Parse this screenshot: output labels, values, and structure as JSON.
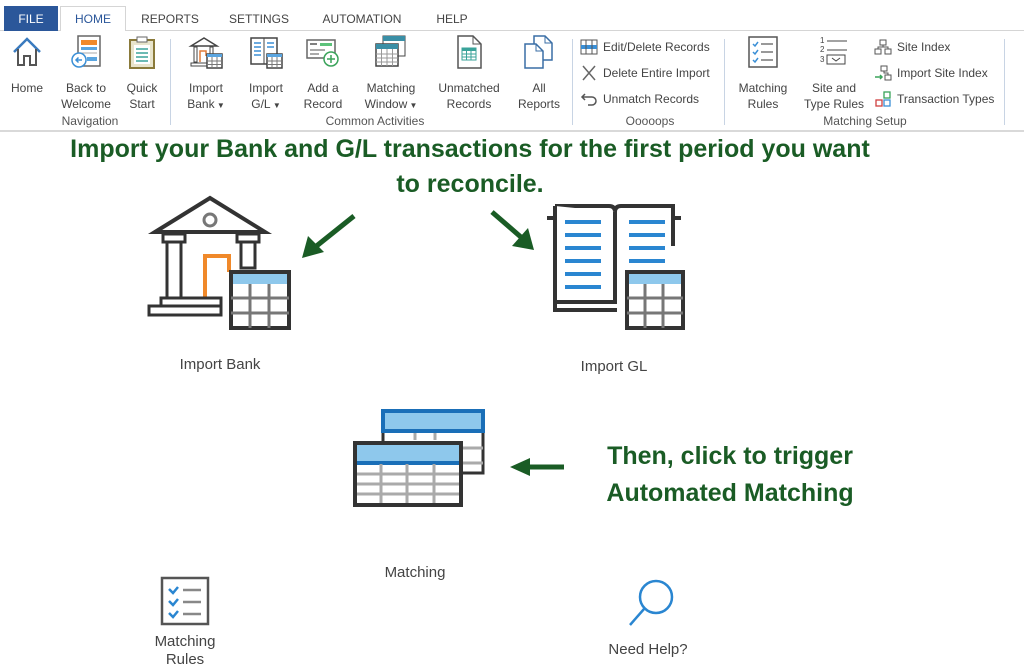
{
  "tabs": [
    "FILE",
    "HOME",
    "REPORTS",
    "SETTINGS",
    "AUTOMATION",
    "HELP"
  ],
  "active_tab": "HOME",
  "ribbon": {
    "navigation": {
      "group_label": "Navigation",
      "buttons": [
        {
          "label": "Home",
          "icon": "home-icon"
        },
        {
          "label": "Back to\nWelcome",
          "icon": "back-icon"
        },
        {
          "label": "Quick\nStart",
          "icon": "clipboard-icon"
        }
      ]
    },
    "common": {
      "group_label": "Common Activities",
      "buttons": [
        {
          "label": "Import\nBank",
          "icon": "bank-icon",
          "dropdown": true
        },
        {
          "label": "Import\nG/L",
          "icon": "ledger-icon",
          "dropdown": true
        },
        {
          "label": "Add a\nRecord",
          "icon": "add-record-icon"
        },
        {
          "label": "Matching\nWindow",
          "icon": "matching-window-icon",
          "dropdown": true
        },
        {
          "label": "Unmatched\nRecords",
          "icon": "unmatched-icon"
        },
        {
          "label": "All\nReports",
          "icon": "reports-icon"
        }
      ]
    },
    "oops": {
      "group_label": "Ooooops",
      "items": [
        {
          "label": "Edit/Delete Records",
          "icon": "grid-icon"
        },
        {
          "label": "Delete Entire Import",
          "icon": "close-icon"
        },
        {
          "label": "Unmatch Records",
          "icon": "undo-icon"
        }
      ]
    },
    "setup": {
      "group_label": "Matching Setup",
      "buttons": [
        {
          "label": "Matching\nRules",
          "icon": "checklist-icon"
        },
        {
          "label": "Site and\nType Rules",
          "icon": "numbered-list-icon"
        }
      ],
      "items": [
        {
          "label": "Site Index",
          "icon": "hierarchy-icon"
        },
        {
          "label": "Import Site Index",
          "icon": "import-hierarchy-icon"
        },
        {
          "label": "Transaction Types",
          "icon": "types-icon"
        }
      ]
    }
  },
  "main": {
    "headline": "Import your Bank and G/L transactions for the first period you want to reconcile.",
    "headline2": "Then, click to trigger Automated Matching",
    "tiles": {
      "import_bank": "Import Bank",
      "import_gl": "Import GL",
      "matching": "Matching",
      "matching_rules": "Matching\nRules",
      "need_help": "Need Help?"
    }
  },
  "colors": {
    "accent": "#2b579a",
    "annotation": "#1a5c25",
    "icon_blue": "#1e88d8",
    "icon_orange": "#f0892a"
  }
}
